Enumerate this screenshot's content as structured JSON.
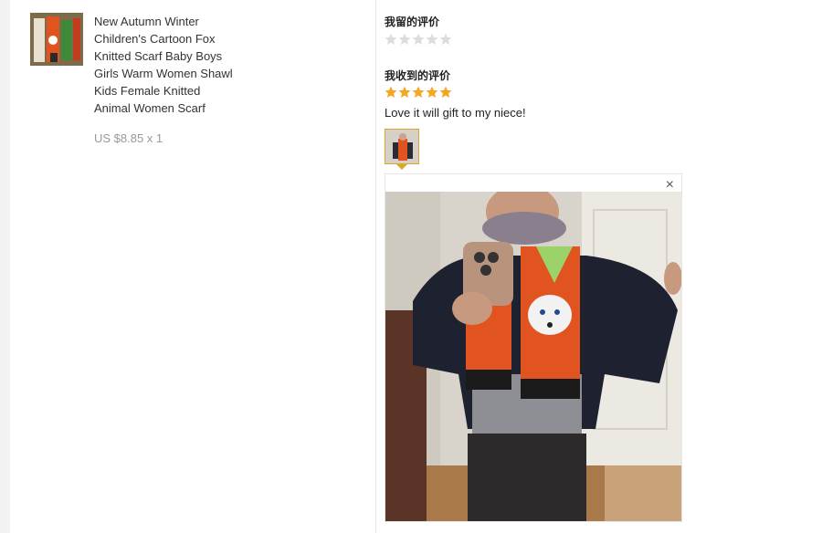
{
  "product": {
    "title_lines": [
      "New Autumn Winter",
      "Children's Cartoon Fox",
      "Knitted Scarf Baby Boys",
      "Girls Warm Women Shawl",
      "Kids Female Knitted",
      "Animal Women Scarf"
    ],
    "price": "US $8.85 x 1"
  },
  "my_review": {
    "heading": "我留的评价",
    "rating": 0,
    "max_rating": 5
  },
  "received_review": {
    "heading": "我收到的评价",
    "rating": 5,
    "max_rating": 5,
    "text": "Love it will gift to my niece!"
  },
  "preview": {
    "close_icon": "×"
  },
  "colors": {
    "star_filled": "#f5a623",
    "star_empty": "#dddddd",
    "accent": "#e0a52b"
  }
}
